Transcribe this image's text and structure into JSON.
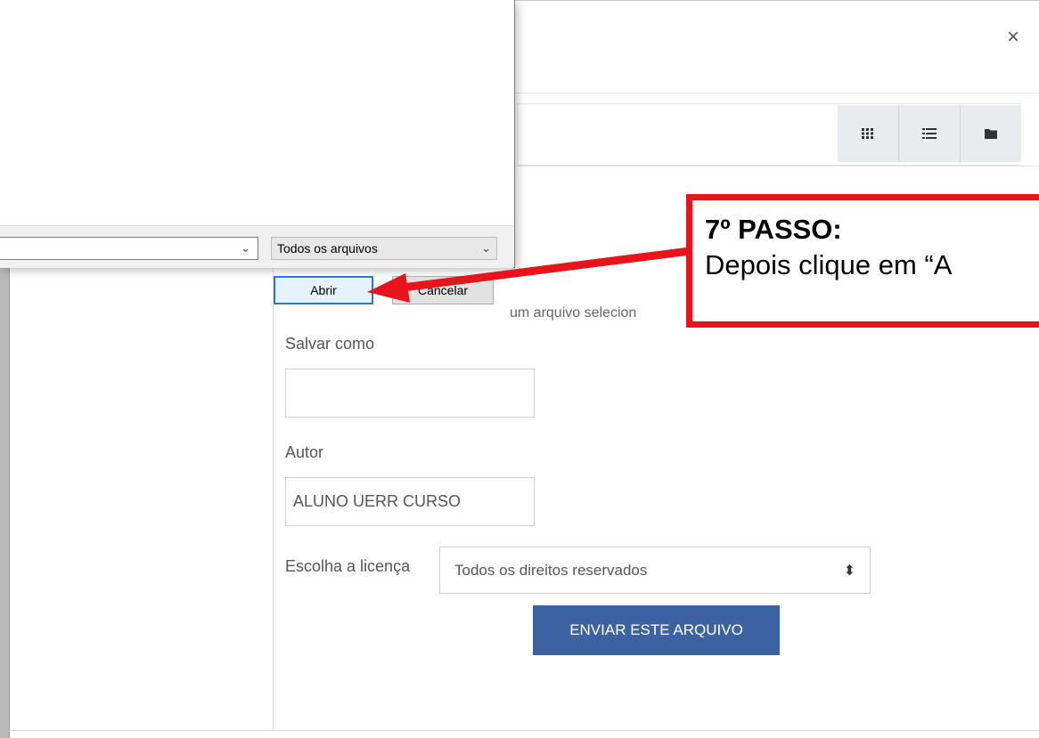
{
  "modal": {
    "close_symbol": "×",
    "view_buttons": [
      {
        "icon": "grid-icon"
      },
      {
        "icon": "list-icon"
      },
      {
        "icon": "folder-icon"
      }
    ],
    "file_status": "um arquivo selecion",
    "save_as_label": "Salvar como",
    "save_as_value": "",
    "author_label": "Autor",
    "author_value": "ALUNO UERR CURSO",
    "license_label": "Escolha a licença",
    "license_value": "Todos os direitos reservados",
    "submit_label": "ENVIAR ESTE ARQUIVO",
    "submit_color": "#3c62a2"
  },
  "file_dialog": {
    "filename_value": "",
    "filter_value": "Todos os arquivos",
    "open_label": "Abrir",
    "cancel_label": "Cancelar"
  },
  "annotation": {
    "title": "7º PASSO:",
    "text": "Depois clique em “A",
    "border_color": "#e8141c"
  }
}
